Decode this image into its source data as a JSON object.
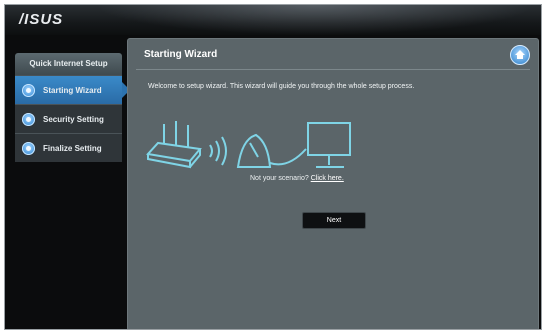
{
  "brand": {
    "logo_text": "/ISUS"
  },
  "sidebar": {
    "header": "Quick Internet Setup",
    "items": [
      {
        "label": "Starting Wizard",
        "active": true
      },
      {
        "label": "Security Setting",
        "active": false
      },
      {
        "label": "Finalize Setting",
        "active": false
      }
    ]
  },
  "main": {
    "title": "Starting Wizard",
    "welcome_text": "Welcome to setup wizard. This wizard will guide you through the whole setup process.",
    "scenario_text": "Not your scenario? ",
    "scenario_link": "Click here.",
    "next_label": "Next"
  },
  "colors": {
    "accent": "#2a6ba6",
    "illustration": "#7fd4e6",
    "panel_bg": "#5b6569"
  },
  "icons": {
    "home": "home-icon",
    "router": "router-icon",
    "wifi_waves": "wifi-waves-icon",
    "modem": "modem-icon",
    "monitor": "monitor-icon"
  }
}
